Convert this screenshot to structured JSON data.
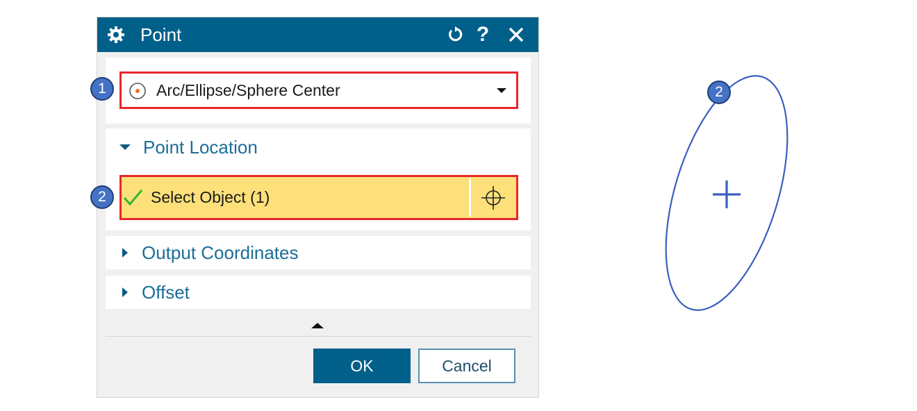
{
  "dialog": {
    "title": "Point",
    "help_glyph": "?",
    "icons": {
      "title": "gear-icon",
      "reset": "reset-icon",
      "help": "help-icon",
      "close": "close-icon"
    }
  },
  "type_selector": {
    "value": "Arc/Ellipse/Sphere Center",
    "icon": "arc-center-icon"
  },
  "point_location": {
    "label": "Point Location",
    "expanded": true,
    "select_object": {
      "label": "Select Object (1)",
      "status_icon": "check-icon",
      "tool_icon": "crosshair-icon"
    }
  },
  "output_coordinates": {
    "label": "Output Coordinates",
    "expanded": false
  },
  "offset": {
    "label": "Offset",
    "expanded": false
  },
  "buttons": {
    "ok": "OK",
    "cancel": "Cancel"
  },
  "callouts": {
    "one": "1",
    "two": "2"
  },
  "colors": {
    "titlebar": "#00608a",
    "selection_highlight": "#fde07a",
    "callout_border": "#e8262b",
    "callout_badge": "#4472c4",
    "check": "#2eb82e",
    "curve": "#3a5ec0"
  }
}
